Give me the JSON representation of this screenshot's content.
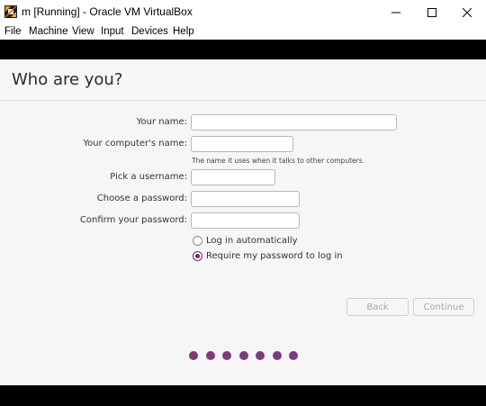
{
  "window": {
    "title": "m [Running] - Oracle VM VirtualBox",
    "app_icon": "virtualbox-icon",
    "controls": [
      "minimize-icon",
      "maximize-icon",
      "close-icon"
    ]
  },
  "menubar": {
    "items": [
      {
        "label": "File"
      },
      {
        "label": "Machine"
      },
      {
        "label": "View"
      },
      {
        "label": "Input"
      },
      {
        "label": "Devices"
      },
      {
        "label": "Help"
      }
    ]
  },
  "installer": {
    "title": "Who are you?",
    "form": {
      "your_name": {
        "label": "Your name:",
        "value": ""
      },
      "computer_name": {
        "label": "Your computer's name:",
        "value": "",
        "hint": "The name it uses when it talks to other computers."
      },
      "username": {
        "label": "Pick a username:",
        "value": ""
      },
      "password": {
        "label": "Choose a password:",
        "value": ""
      },
      "confirm_password": {
        "label": "Confirm your password:",
        "value": ""
      }
    },
    "login_options": [
      {
        "label": "Log in automatically",
        "selected": false
      },
      {
        "label": "Require my password to log in",
        "selected": true
      }
    ],
    "buttons": {
      "back": {
        "label": "Back",
        "enabled": false
      },
      "continue": {
        "label": "Continue",
        "enabled": false
      }
    },
    "progress": {
      "steps": 7
    },
    "accent_color": "#77216f"
  }
}
